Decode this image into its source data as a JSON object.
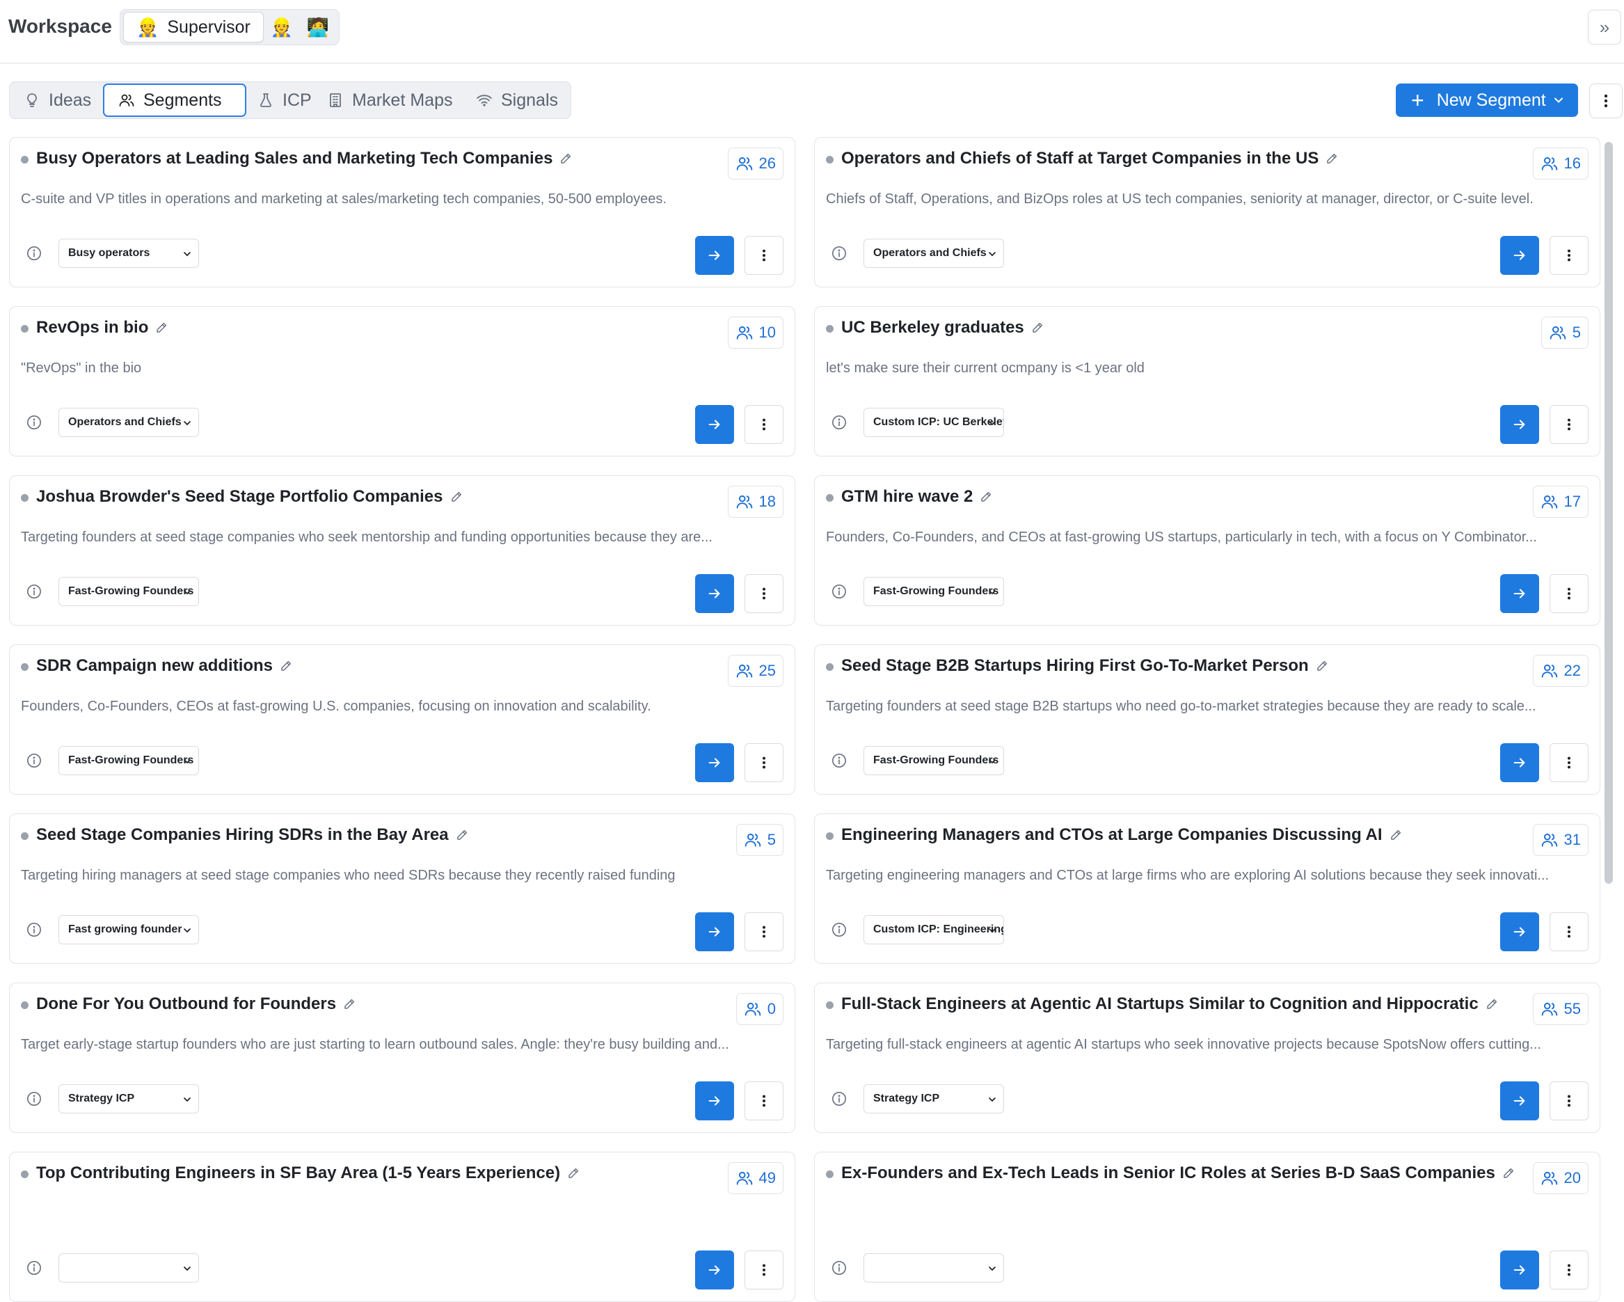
{
  "header": {
    "title": "Workspace",
    "roles": [
      {
        "label": "Supervisor",
        "emoji": "👷",
        "active": true
      },
      {
        "label": "",
        "emoji": "👷",
        "active": false
      },
      {
        "label": "",
        "emoji": "🧑‍💻",
        "active": false
      }
    ],
    "expand_icon": "»"
  },
  "tabs": [
    {
      "label": "Ideas",
      "icon": "lightbulb-icon"
    },
    {
      "label": "Segments",
      "icon": "users-icon",
      "active": true
    },
    {
      "label": "ICP",
      "icon": "flask-icon"
    },
    {
      "label": "Market Maps",
      "icon": "building-icon"
    },
    {
      "label": "Signals",
      "icon": "wifi-icon"
    }
  ],
  "actions": {
    "new_segment_label": "New Segment"
  },
  "colors": {
    "accent": "#1f7ae0",
    "count_text": "#1f6fd6",
    "muted": "#6b7280"
  },
  "segments": [
    {
      "title": "Busy Operators at Leading Sales and Marketing Tech Companies",
      "count": "26",
      "description": "C-suite and VP titles in operations and marketing at sales/marketing tech companies, 50-500 employees.",
      "icp": "Busy operators"
    },
    {
      "title": "Operators and Chiefs of Staff at Target Companies in the US",
      "count": "16",
      "description": "Chiefs of Staff, Operations, and BizOps roles at US tech companies, seniority at manager, director, or C-suite level.",
      "icp": "Operators and Chiefs"
    },
    {
      "title": "RevOps in bio",
      "count": "10",
      "description": "\"RevOps\" in the bio",
      "icp": "Operators and Chiefs"
    },
    {
      "title": "UC Berkeley graduates",
      "count": "5",
      "description": "let's make sure their current ocmpany is <1 year old",
      "icp": "Custom ICP: UC Berkeley"
    },
    {
      "title": "Joshua Browder's Seed Stage Portfolio Companies",
      "count": "18",
      "description": "Targeting founders at seed stage companies who seek mentorship and funding opportunities because they are...",
      "icp": "Fast-Growing Founders"
    },
    {
      "title": "GTM hire wave 2",
      "count": "17",
      "description": "Founders, Co-Founders, and CEOs at fast-growing US startups, particularly in tech, with a focus on Y Combinator...",
      "icp": "Fast-Growing Founders"
    },
    {
      "title": "SDR Campaign new additions",
      "count": "25",
      "description": "Founders, Co-Founders, CEOs at fast-growing U.S. companies, focusing on innovation and scalability.",
      "icp": "Fast-Growing Founders"
    },
    {
      "title": "Seed Stage B2B Startups Hiring First Go-To-Market Person",
      "count": "22",
      "description": "Targeting founders at seed stage B2B startups who need go-to-market strategies because they are ready to scale...",
      "icp": "Fast-Growing Founders"
    },
    {
      "title": "Seed Stage Companies Hiring SDRs in the Bay Area",
      "count": "5",
      "description": "Targeting hiring managers at seed stage companies who need SDRs because they recently raised funding",
      "icp": "Fast growing founder"
    },
    {
      "title": "Engineering Managers and CTOs at Large Companies Discussing AI",
      "count": "31",
      "description": "Targeting engineering managers and CTOs at large firms who are exploring AI solutions because they seek innovati...",
      "icp": "Custom ICP: Engineering"
    },
    {
      "title": "Done For You Outbound for Founders",
      "count": "0",
      "description": "Target early-stage startup founders who are just starting to learn outbound sales. Angle: they're busy building and...",
      "icp": "Strategy ICP"
    },
    {
      "title": "Full-Stack Engineers at Agentic AI Startups Similar to Cognition and Hippocratic",
      "count": "55",
      "description": "Targeting full-stack engineers at agentic AI startups who seek innovative projects because SpotsNow offers cutting...",
      "icp": "Strategy ICP"
    },
    {
      "title": "Top Contributing Engineers in SF Bay Area (1-5 Years Experience)",
      "count": "49",
      "description": "",
      "icp": ""
    },
    {
      "title": "Ex-Founders and Ex-Tech Leads in Senior IC Roles at Series B-D SaaS Companies",
      "count": "20",
      "description": "",
      "icp": ""
    }
  ]
}
